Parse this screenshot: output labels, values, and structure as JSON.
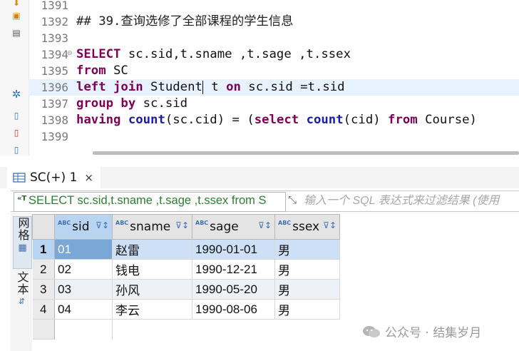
{
  "editor": {
    "line_numbers": [
      "1391",
      "1392",
      "1393",
      "1394",
      "1395",
      "1396",
      "1397",
      "1398",
      "1399"
    ],
    "lines": [
      [],
      [
        {
          "t": "## 39.查询选修了全部课程的学生信息",
          "c": "cm"
        }
      ],
      [],
      [
        {
          "t": "SELECT",
          "c": "kw"
        },
        {
          "t": " sc.sid,t.sname ,t.sage ,t.ssex",
          "c": ""
        }
      ],
      [
        {
          "t": "from",
          "c": "kw"
        },
        {
          "t": " SC",
          "c": ""
        }
      ],
      [
        {
          "t": "left join",
          "c": "kw"
        },
        {
          "t": " Student",
          "c": ""
        },
        {
          "t": "|caret",
          "c": "caret"
        },
        {
          "t": " t ",
          "c": ""
        },
        {
          "t": "on",
          "c": "kw"
        },
        {
          "t": " sc.sid =t.sid",
          "c": ""
        }
      ],
      [
        {
          "t": "group by",
          "c": "kw"
        },
        {
          "t": " sc.sid",
          "c": ""
        }
      ],
      [
        {
          "t": "having",
          "c": "kw"
        },
        {
          "t": " ",
          "c": ""
        },
        {
          "t": "count",
          "c": "fn"
        },
        {
          "t": "(sc.cid) = (",
          "c": ""
        },
        {
          "t": "select",
          "c": "kw"
        },
        {
          "t": " ",
          "c": ""
        },
        {
          "t": "count",
          "c": "fn"
        },
        {
          "t": "(cid) ",
          "c": ""
        },
        {
          "t": "from",
          "c": "kw"
        },
        {
          "t": " Course)",
          "c": ""
        }
      ],
      []
    ]
  },
  "result_tab": {
    "label": "SC(+) 1",
    "close": "×"
  },
  "filter": {
    "sql_text": "SELECT sc.sid,t.sname ,t.sage ,t.ssex from S",
    "placeholder": "输入一个 SQL 表达式来过滤结果 (使用"
  },
  "side_tabs": {
    "grid": "网格",
    "text": "文本"
  },
  "grid": {
    "columns": [
      "sid",
      "sname",
      "sage",
      "ssex"
    ],
    "rows": [
      {
        "n": "1",
        "cells": [
          "01",
          "赵雷",
          "1990-01-01",
          "男"
        ]
      },
      {
        "n": "2",
        "cells": [
          "02",
          "钱电",
          "1990-12-21",
          "男"
        ]
      },
      {
        "n": "3",
        "cells": [
          "03",
          "孙风",
          "1990-05-20",
          "男"
        ]
      },
      {
        "n": "4",
        "cells": [
          "04",
          "李云",
          "1990-08-06",
          "男"
        ]
      }
    ]
  },
  "watermark": "公众号 · 结集岁月"
}
